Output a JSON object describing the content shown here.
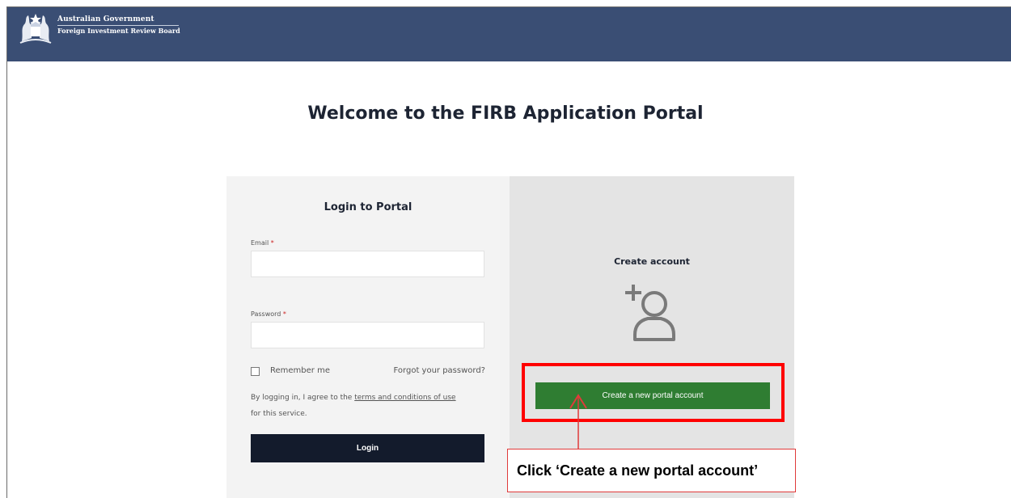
{
  "header": {
    "gov_line1": "Australian Government",
    "gov_line2": "Foreign Investment Review Board"
  },
  "page_title": "Welcome to the FIRB Application Portal",
  "login": {
    "title": "Login to Portal",
    "email_label": "Email",
    "password_label": "Password",
    "required_mark": "*",
    "email_value": "",
    "password_value": "",
    "remember_label": "Remember me",
    "remember_checked": false,
    "forgot_link": "Forgot your password?",
    "agree_prefix": "By logging in, I agree to the ",
    "terms_link": "terms and conditions of use",
    "agree_suffix": "for this service.",
    "login_button": "Login"
  },
  "create": {
    "title": "Create account",
    "icon": "user-plus-icon",
    "button": "Create a new portal account"
  },
  "annotation": {
    "callout_text": "Click ‘Create a new portal account’"
  },
  "colors": {
    "header_bg": "#3a4e74",
    "login_button_bg": "#131b2c",
    "create_button_bg": "#2f7d32",
    "highlight": "#ff0000"
  }
}
